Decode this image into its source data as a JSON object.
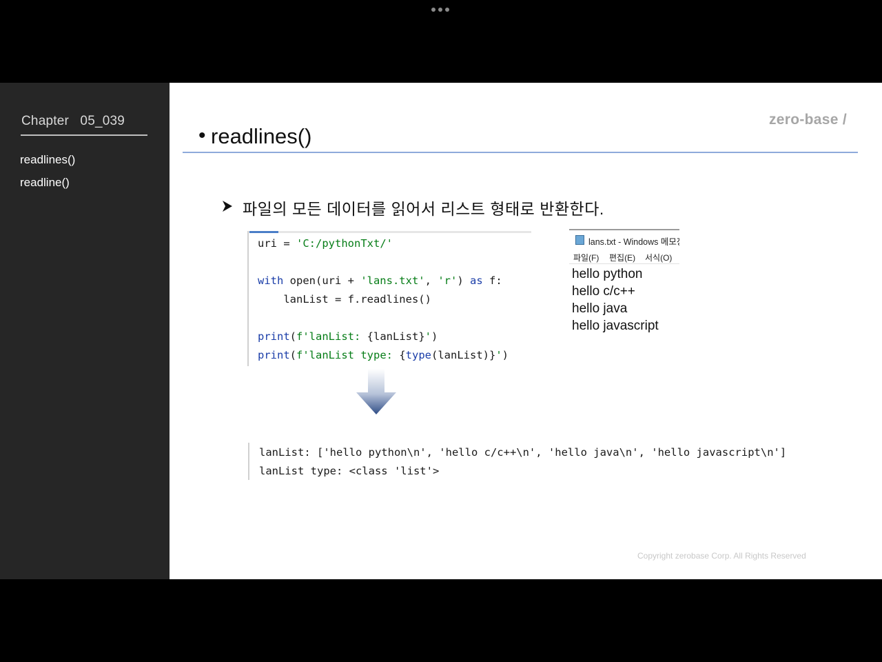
{
  "sidebar": {
    "chapter": "Chapter   05_039",
    "items": [
      {
        "label": "readlines()"
      },
      {
        "label": "readline()"
      }
    ]
  },
  "logo": "zero-base /",
  "slide": {
    "bullet": "•",
    "title": "readlines()",
    "description": "파일의 모든 데이터를 읽어서 리스트 형태로 반환한다."
  },
  "code": {
    "line1": {
      "var": "uri = ",
      "str": "'C:/pythonTxt/'"
    },
    "line3": {
      "kw1": "with",
      "plain1": " open(uri + ",
      "str1": "'lans.txt'",
      "plain2": ", ",
      "str2": "'r'",
      "plain3": ") ",
      "kw2": "as",
      "plain4": " f:"
    },
    "line4": "    lanList = f.readlines()",
    "line6": {
      "fn": "print",
      "plain1": "(",
      "str1": "f'lanList: ",
      "plain2": "{lanList}",
      "str2": "'",
      "plain3": ")"
    },
    "line7": {
      "fn": "print",
      "plain1": "(",
      "str1": "f'lanList type: ",
      "plain2": "{",
      "fn2": "type",
      "plain3": "(lanList)}",
      "str2": "'",
      "plain4": ")"
    }
  },
  "notepad": {
    "title": "lans.txt - Windows 메모장",
    "menu": [
      "파일(F)",
      "편집(E)",
      "서식(O)"
    ],
    "lines": [
      "hello python",
      "hello c/c++",
      "hello java",
      "hello javascript"
    ]
  },
  "output": {
    "line1": "lanList: ['hello python\\n', 'hello c/c++\\n', 'hello java\\n', 'hello javascript\\n']",
    "line2": "lanList type: <class 'list'>"
  },
  "copyright": "Copyright zerobase Corp. All Rights Reserved",
  "colors": {
    "sidebar_bg": "#262626",
    "title_rule": "#8eaadb",
    "keyword": "#1a3da8",
    "string": "#067d17",
    "logo": "#a6a6a6"
  }
}
